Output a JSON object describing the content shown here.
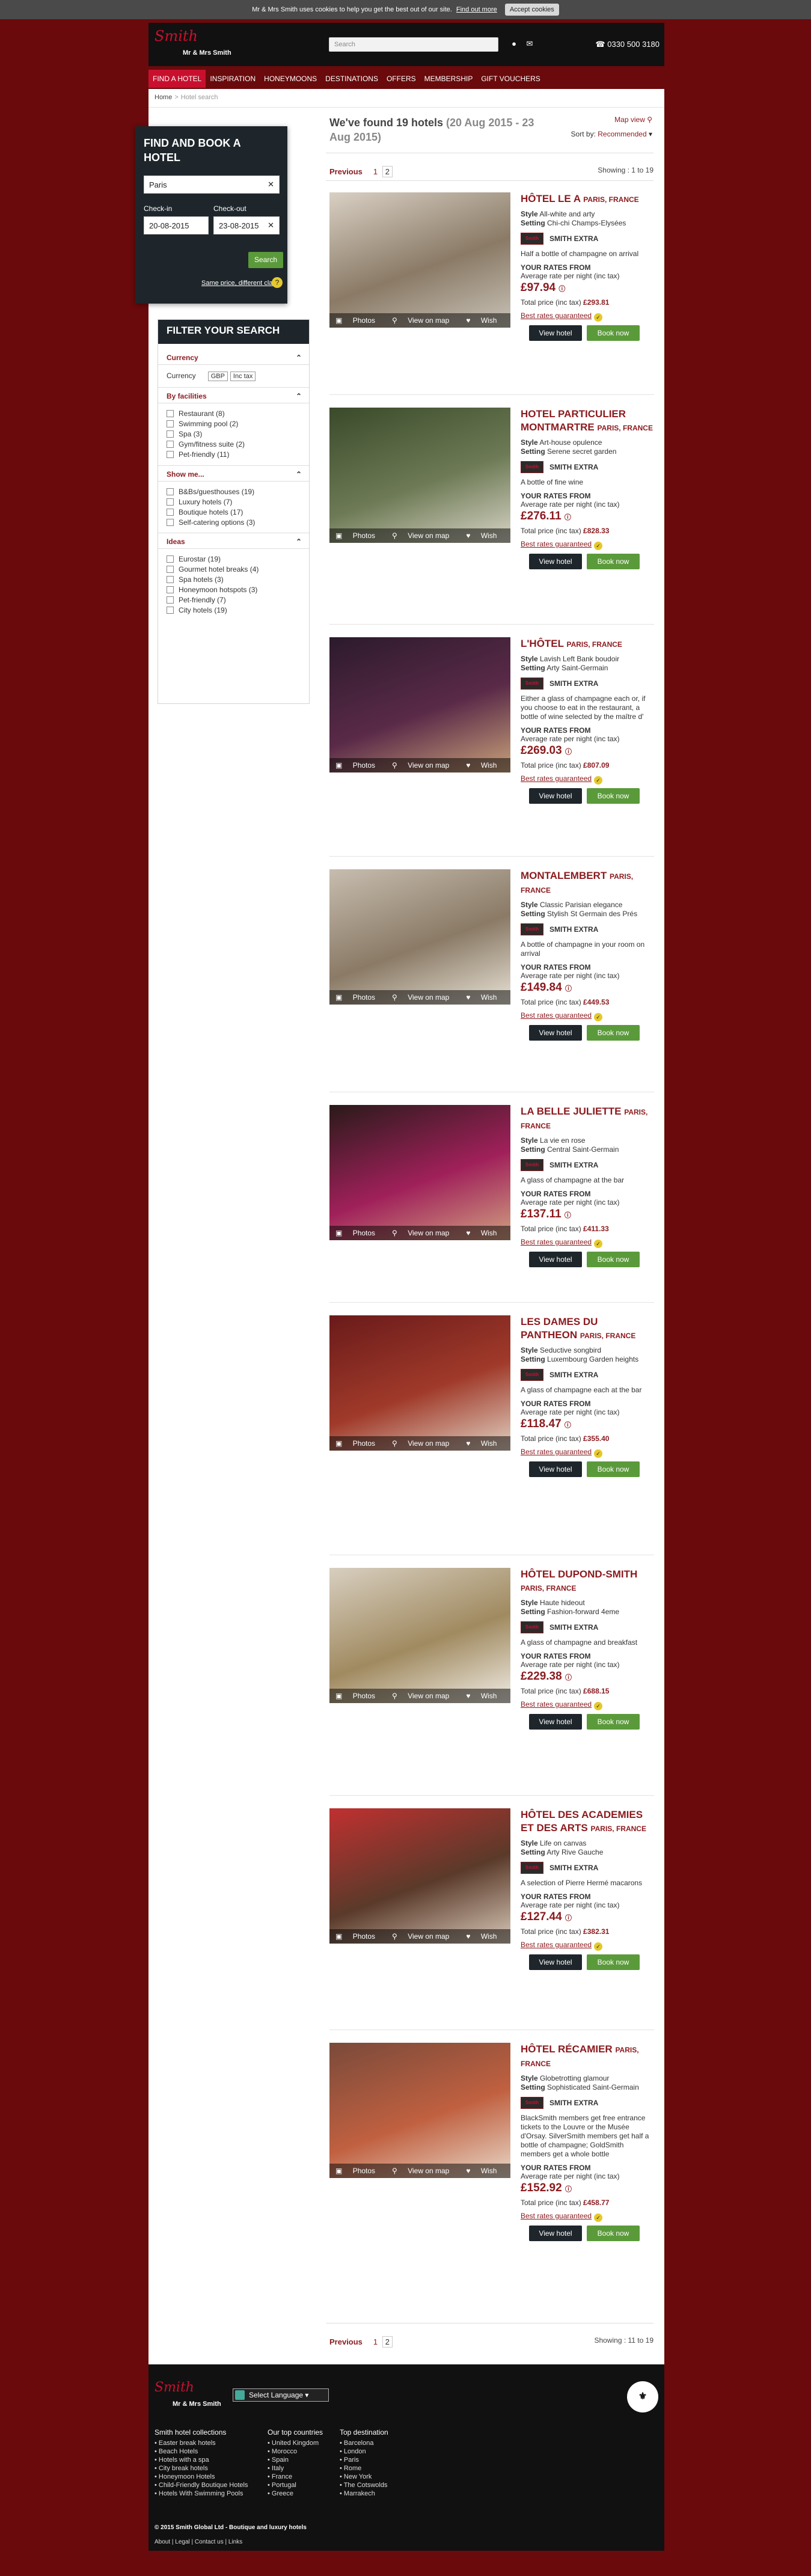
{
  "cookie": {
    "text": "Mr & Mrs Smith uses cookies to help you get the best out of our site.",
    "link": "Find out more",
    "accept": "Accept cookies"
  },
  "header": {
    "logo": "Smith",
    "logo_sub": "Mr & Mrs Smith",
    "search_placeholder": "Search",
    "phone": "0330 500 3180",
    "nav": [
      "Find a hotel",
      "Inspiration",
      "Honeymoons",
      "Destinations",
      "Offers",
      "Membership",
      "Gift vouchers"
    ]
  },
  "breadcrumb": {
    "home": "Home",
    "sep": ">",
    "current": "Hotel search"
  },
  "booking": {
    "title": "Find and book a hotel",
    "destination": "Paris",
    "checkin_label": "Check-in",
    "checkout_label": "Check-out",
    "checkin": "20-08-2015",
    "checkout": "23-08-2015",
    "search": "Search",
    "diff": "Same price, different class",
    "help": "?"
  },
  "filter": {
    "title": "Filter your search",
    "currency": {
      "title": "Currency",
      "label": "Currency",
      "value": "GBP",
      "tax": "Inc tax"
    },
    "facilities": {
      "title": "By facilities",
      "items": [
        "Restaurant (8)",
        "Swimming pool (2)",
        "Spa (3)",
        "Gym/fitness suite (2)",
        "Pet-friendly (11)"
      ]
    },
    "show": {
      "title": "Show me...",
      "items": [
        "B&Bs/guesthouses (19)",
        "Luxury hotels (7)",
        "Boutique hotels (17)",
        "Self-catering options (3)"
      ]
    },
    "ideas": {
      "title": "Ideas",
      "items": [
        "Eurostar (19)",
        "Gourmet hotel breaks (4)",
        "Spa hotels (3)",
        "Honeymoon hotspots (3)",
        "Pet-friendly (7)",
        "City hotels (19)"
      ]
    }
  },
  "results": {
    "heading": "We've found 19 hotels",
    "dates": "(20 Aug 2015 - 23 Aug 2015)",
    "mapview": "Map view",
    "sort_label": "Sort by:",
    "sort_value": "Recommended",
    "prev": "Previous",
    "pages": [
      "1",
      "2"
    ],
    "showing_top": "Showing : 1 to 19",
    "showing_bottom": "Showing : 11 to 19"
  },
  "labels": {
    "photos": "Photos",
    "map": "View on map",
    "wish": "Wish list",
    "style": "Style",
    "setting": "Setting",
    "smith_extra": "SMITH EXTRA",
    "rates_from": "YOUR RATES FROM",
    "avg": "Average rate per night (inc tax)",
    "total": "Total price (inc tax)",
    "best": "Best rates guaranteed",
    "view": "View hotel",
    "book": "Book now"
  },
  "hotels": [
    {
      "name": "Hôtel Le A",
      "city": "Paris, France",
      "style": "All-white and arty",
      "setting": "Chi-chi Champs-Elysées",
      "extra": "Half a bottle of champagne on arrival",
      "price": "£97.94",
      "total": "£293.81",
      "colors": [
        "#d9d0c4",
        "#8a7a66",
        "#c9c3b8"
      ]
    },
    {
      "name": "Hotel Particulier Montmartre",
      "city": "Paris, France",
      "style": "Art-house opulence",
      "setting": "Serene secret garden",
      "extra": "A bottle of fine wine",
      "price": "£276.11",
      "total": "£828.33",
      "colors": [
        "#3a4a2a",
        "#6d7a55",
        "#d8d4c6"
      ]
    },
    {
      "name": "L'Hôtel",
      "city": "Paris, France",
      "style": "Lavish Left Bank boudoir",
      "setting": "Arty Saint-Germain",
      "extra": "Either a glass of champagne each or, if you choose to eat in the restaurant, a bottle of wine selected by the maître d'",
      "price": "£269.03",
      "total": "£807.09",
      "colors": [
        "#2c1a2c",
        "#5a2a48",
        "#c9a27a"
      ]
    },
    {
      "name": "Montalembert",
      "city": "Paris, France",
      "style": "Classic Parisian elegance",
      "setting": "Stylish St Germain des Prés",
      "extra": "A bottle of champagne in your room on arrival",
      "price": "£149.84",
      "total": "£449.53",
      "colors": [
        "#c7bdaf",
        "#8a7a66",
        "#e8e2d6"
      ]
    },
    {
      "name": "La Belle Juliette",
      "city": "Paris, France",
      "style": "La vie en rose",
      "setting": "Central Saint-Germain",
      "extra": "A glass of champagne at the bar",
      "price": "£137.11",
      "total": "£411.33",
      "colors": [
        "#2a1a1a",
        "#a0205a",
        "#d0a080"
      ]
    },
    {
      "name": "Les Dames du Pantheon",
      "city": "Paris, France",
      "style": "Seductive songbird",
      "setting": "Luxembourg Garden heights",
      "extra": "A glass of champagne each at the bar",
      "price": "£118.47",
      "total": "£355.40",
      "colors": [
        "#6a1a1a",
        "#a03a2a",
        "#e0d0c0"
      ]
    },
    {
      "name": "Hôtel Dupond-Smith",
      "city": "Paris, France",
      "style": "Haute hideout",
      "setting": "Fashion-forward 4eme",
      "extra": "A glass of champagne and breakfast",
      "price": "£229.38",
      "total": "£688.15",
      "colors": [
        "#d8cfc0",
        "#a08a60",
        "#f0ece4"
      ]
    },
    {
      "name": "Hôtel des Academies et des Arts",
      "city": "Paris, France",
      "style": "Life on canvas",
      "setting": "Arty Rive Gauche",
      "extra": "A selection of Pierre Hermé macarons",
      "price": "£127.44",
      "total": "£382.31",
      "colors": [
        "#c03030",
        "#5a3a2a",
        "#d8c8b8"
      ]
    },
    {
      "name": "Hôtel Récamier",
      "city": "Paris, France",
      "style": "Globetrotting glamour",
      "setting": "Sophisticated Saint-Germain",
      "extra": "BlackSmith members get free entrance tickets to the Louvre or the Musée d'Orsay. SilverSmith members get half a bottle of champagne; GoldSmith members get a whole bottle",
      "price": "£152.92",
      "total": "£458.77",
      "colors": [
        "#7a4a3a",
        "#c06040",
        "#e8d8c8"
      ]
    }
  ],
  "footer": {
    "logo": "Smith",
    "logo_sub": "Mr & Mrs Smith",
    "lang": "Select Language",
    "seal": "⚜",
    "cols": [
      {
        "title": "Smith hotel collections",
        "items": [
          "Easter break hotels",
          "Beach Hotels",
          "Hotels with a spa",
          "City break hotels",
          "Honeymoon Hotels",
          "Child-Friendly Boutique Hotels",
          "Hotels With Swimming Pools"
        ]
      },
      {
        "title": "Our top countries",
        "items": [
          "United Kingdom",
          "Morocco",
          "Spain",
          "Italy",
          "France",
          "Portugal",
          "Greece"
        ]
      },
      {
        "title": "Top destination",
        "items": [
          "Barcelona",
          "London",
          "Paris",
          "Rome",
          "New York",
          "The Cotswolds",
          "Marrakech"
        ]
      }
    ],
    "copy": "© 2015 Smith Global Ltd - Boutique and luxury hotels",
    "links": "About | Legal | Contact us | Links"
  },
  "colors": {
    "brand": "#8b1a1e",
    "bg": "#6a0a0c",
    "green": "#5b9a3a",
    "dark": "#1e262b"
  }
}
